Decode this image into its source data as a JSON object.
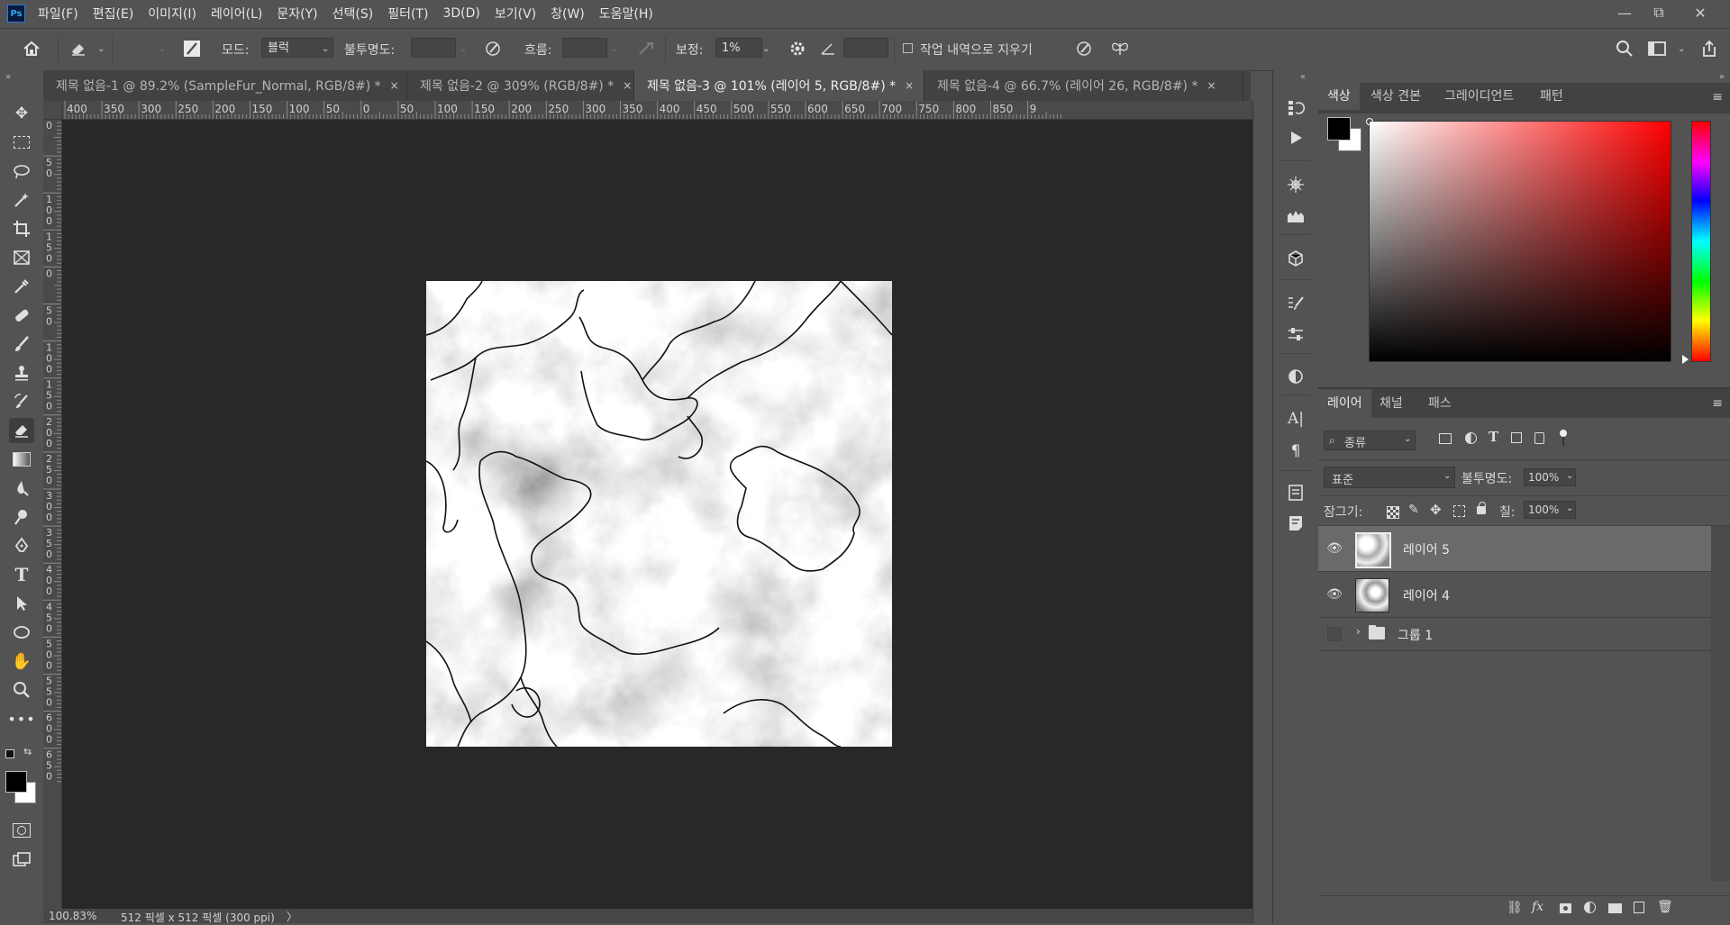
{
  "app": {
    "logo": "Ps"
  },
  "menu": [
    "파일(F)",
    "편집(E)",
    "이미지(I)",
    "레이어(L)",
    "문자(Y)",
    "선택(S)",
    "필터(T)",
    "3D(D)",
    "보기(V)",
    "창(W)",
    "도움말(H)"
  ],
  "window_controls": {
    "minimize": "—",
    "restore": "⧉",
    "close": "✕"
  },
  "options": {
    "mode_label": "모드:",
    "mode_value": "블럭",
    "opacity_label": "불투명도:",
    "flow_label": "흐름:",
    "smoothing_label": "보정:",
    "smoothing_value": "1%",
    "erase_history_label": "작업 내역으로 지우기"
  },
  "tabs": [
    {
      "label": "제목 없음-1 @ 89.2% (SampleFur_Normal, RGB/8#) *",
      "close": "×",
      "active": false
    },
    {
      "label": "제목 없음-2 @ 309% (RGB/8#) *",
      "close": "×",
      "active": false
    },
    {
      "label": "제목 없음-3 @ 101% (레이어 5, RGB/8#) *",
      "close": "×",
      "active": true
    },
    {
      "label": "제목 없음-4 @ 66.7% (레이어 26, RGB/8#) *",
      "close": "×",
      "active": false
    }
  ],
  "ruler_h": [
    "400",
    "350",
    "300",
    "250",
    "200",
    "150",
    "100",
    "50",
    "0",
    "50",
    "100",
    "150",
    "200",
    "250",
    "300",
    "350",
    "400",
    "450",
    "500",
    "550",
    "600",
    "650",
    "700",
    "750",
    "800",
    "850",
    "9"
  ],
  "ruler_v": [
    "0",
    "5\n0",
    "1\n0\n0",
    "1\n5\n0",
    "0",
    "5\n0",
    "1\n0\n0",
    "1\n5\n0",
    "2\n0\n0",
    "2\n5\n0",
    "3\n0\n0",
    "3\n5\n0",
    "4\n0\n0",
    "4\n5\n0",
    "5\n0\n0",
    "5\n5\n0",
    "6\n0\n0",
    "6\n5\n0"
  ],
  "status": {
    "zoom": "100.83%",
    "doc_info": "512 픽셀 x 512 픽셀 (300 ppi)",
    "arrow": "〉"
  },
  "color_panel": {
    "tabs": [
      "색상",
      "색상 견본",
      "그레이디언트",
      "패턴"
    ],
    "menu": "≡",
    "foreground": "#000000",
    "background": "#ffffff"
  },
  "layers_panel": {
    "tabs": [
      "레이어",
      "채널",
      "패스"
    ],
    "menu": "≡",
    "filter_value": "종류",
    "blend_mode": "표준",
    "opacity_label": "불투명도:",
    "opacity_value": "100%",
    "lock_label": "잠그기:",
    "fill_label": "칠:",
    "fill_value": "100%",
    "layers": [
      {
        "name": "레이어 5",
        "visible": true,
        "selected": true
      },
      {
        "name": "레이어 4",
        "visible": true,
        "selected": false
      },
      {
        "name": "그룹 1",
        "visible": false,
        "selected": false,
        "type": "group"
      }
    ]
  },
  "icons": {
    "home": "home-icon",
    "eraser": "eraser-icon",
    "brush": "brush-icon",
    "airbrush": "airbrush-icon",
    "settings": "gear-icon",
    "angle": "angle-icon",
    "pressure": "pressure-icon",
    "symmetry": "butterfly-icon",
    "search": "search-icon",
    "workspace": "workspace-icon",
    "share": "share-icon"
  }
}
